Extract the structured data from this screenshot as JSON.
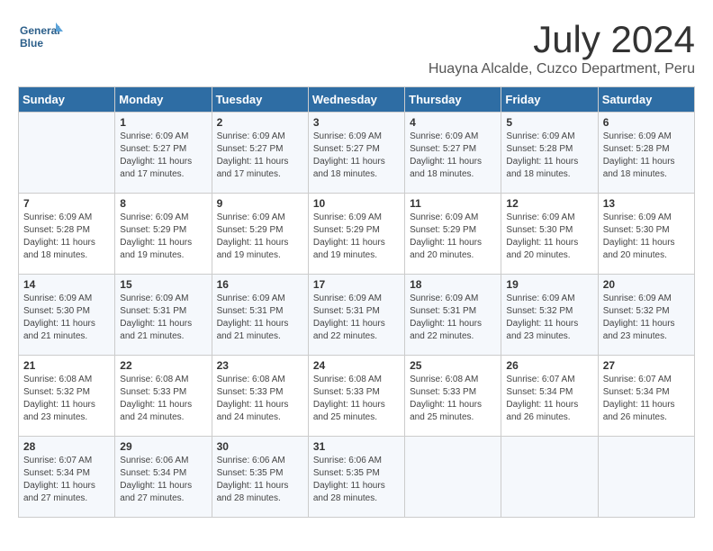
{
  "header": {
    "logo_line1": "General",
    "logo_line2": "Blue",
    "month": "July 2024",
    "location": "Huayna Alcalde, Cuzco Department, Peru"
  },
  "columns": [
    "Sunday",
    "Monday",
    "Tuesday",
    "Wednesday",
    "Thursday",
    "Friday",
    "Saturday"
  ],
  "weeks": [
    [
      {
        "day": "",
        "info": ""
      },
      {
        "day": "1",
        "info": "Sunrise: 6:09 AM\nSunset: 5:27 PM\nDaylight: 11 hours\nand 17 minutes."
      },
      {
        "day": "2",
        "info": "Sunrise: 6:09 AM\nSunset: 5:27 PM\nDaylight: 11 hours\nand 17 minutes."
      },
      {
        "day": "3",
        "info": "Sunrise: 6:09 AM\nSunset: 5:27 PM\nDaylight: 11 hours\nand 18 minutes."
      },
      {
        "day": "4",
        "info": "Sunrise: 6:09 AM\nSunset: 5:27 PM\nDaylight: 11 hours\nand 18 minutes."
      },
      {
        "day": "5",
        "info": "Sunrise: 6:09 AM\nSunset: 5:28 PM\nDaylight: 11 hours\nand 18 minutes."
      },
      {
        "day": "6",
        "info": "Sunrise: 6:09 AM\nSunset: 5:28 PM\nDaylight: 11 hours\nand 18 minutes."
      }
    ],
    [
      {
        "day": "7",
        "info": "Sunrise: 6:09 AM\nSunset: 5:28 PM\nDaylight: 11 hours\nand 18 minutes."
      },
      {
        "day": "8",
        "info": "Sunrise: 6:09 AM\nSunset: 5:29 PM\nDaylight: 11 hours\nand 19 minutes."
      },
      {
        "day": "9",
        "info": "Sunrise: 6:09 AM\nSunset: 5:29 PM\nDaylight: 11 hours\nand 19 minutes."
      },
      {
        "day": "10",
        "info": "Sunrise: 6:09 AM\nSunset: 5:29 PM\nDaylight: 11 hours\nand 19 minutes."
      },
      {
        "day": "11",
        "info": "Sunrise: 6:09 AM\nSunset: 5:29 PM\nDaylight: 11 hours\nand 20 minutes."
      },
      {
        "day": "12",
        "info": "Sunrise: 6:09 AM\nSunset: 5:30 PM\nDaylight: 11 hours\nand 20 minutes."
      },
      {
        "day": "13",
        "info": "Sunrise: 6:09 AM\nSunset: 5:30 PM\nDaylight: 11 hours\nand 20 minutes."
      }
    ],
    [
      {
        "day": "14",
        "info": "Sunrise: 6:09 AM\nSunset: 5:30 PM\nDaylight: 11 hours\nand 21 minutes."
      },
      {
        "day": "15",
        "info": "Sunrise: 6:09 AM\nSunset: 5:31 PM\nDaylight: 11 hours\nand 21 minutes."
      },
      {
        "day": "16",
        "info": "Sunrise: 6:09 AM\nSunset: 5:31 PM\nDaylight: 11 hours\nand 21 minutes."
      },
      {
        "day": "17",
        "info": "Sunrise: 6:09 AM\nSunset: 5:31 PM\nDaylight: 11 hours\nand 22 minutes."
      },
      {
        "day": "18",
        "info": "Sunrise: 6:09 AM\nSunset: 5:31 PM\nDaylight: 11 hours\nand 22 minutes."
      },
      {
        "day": "19",
        "info": "Sunrise: 6:09 AM\nSunset: 5:32 PM\nDaylight: 11 hours\nand 23 minutes."
      },
      {
        "day": "20",
        "info": "Sunrise: 6:09 AM\nSunset: 5:32 PM\nDaylight: 11 hours\nand 23 minutes."
      }
    ],
    [
      {
        "day": "21",
        "info": "Sunrise: 6:08 AM\nSunset: 5:32 PM\nDaylight: 11 hours\nand 23 minutes."
      },
      {
        "day": "22",
        "info": "Sunrise: 6:08 AM\nSunset: 5:33 PM\nDaylight: 11 hours\nand 24 minutes."
      },
      {
        "day": "23",
        "info": "Sunrise: 6:08 AM\nSunset: 5:33 PM\nDaylight: 11 hours\nand 24 minutes."
      },
      {
        "day": "24",
        "info": "Sunrise: 6:08 AM\nSunset: 5:33 PM\nDaylight: 11 hours\nand 25 minutes."
      },
      {
        "day": "25",
        "info": "Sunrise: 6:08 AM\nSunset: 5:33 PM\nDaylight: 11 hours\nand 25 minutes."
      },
      {
        "day": "26",
        "info": "Sunrise: 6:07 AM\nSunset: 5:34 PM\nDaylight: 11 hours\nand 26 minutes."
      },
      {
        "day": "27",
        "info": "Sunrise: 6:07 AM\nSunset: 5:34 PM\nDaylight: 11 hours\nand 26 minutes."
      }
    ],
    [
      {
        "day": "28",
        "info": "Sunrise: 6:07 AM\nSunset: 5:34 PM\nDaylight: 11 hours\nand 27 minutes."
      },
      {
        "day": "29",
        "info": "Sunrise: 6:06 AM\nSunset: 5:34 PM\nDaylight: 11 hours\nand 27 minutes."
      },
      {
        "day": "30",
        "info": "Sunrise: 6:06 AM\nSunset: 5:35 PM\nDaylight: 11 hours\nand 28 minutes."
      },
      {
        "day": "31",
        "info": "Sunrise: 6:06 AM\nSunset: 5:35 PM\nDaylight: 11 hours\nand 28 minutes."
      },
      {
        "day": "",
        "info": ""
      },
      {
        "day": "",
        "info": ""
      },
      {
        "day": "",
        "info": ""
      }
    ]
  ]
}
